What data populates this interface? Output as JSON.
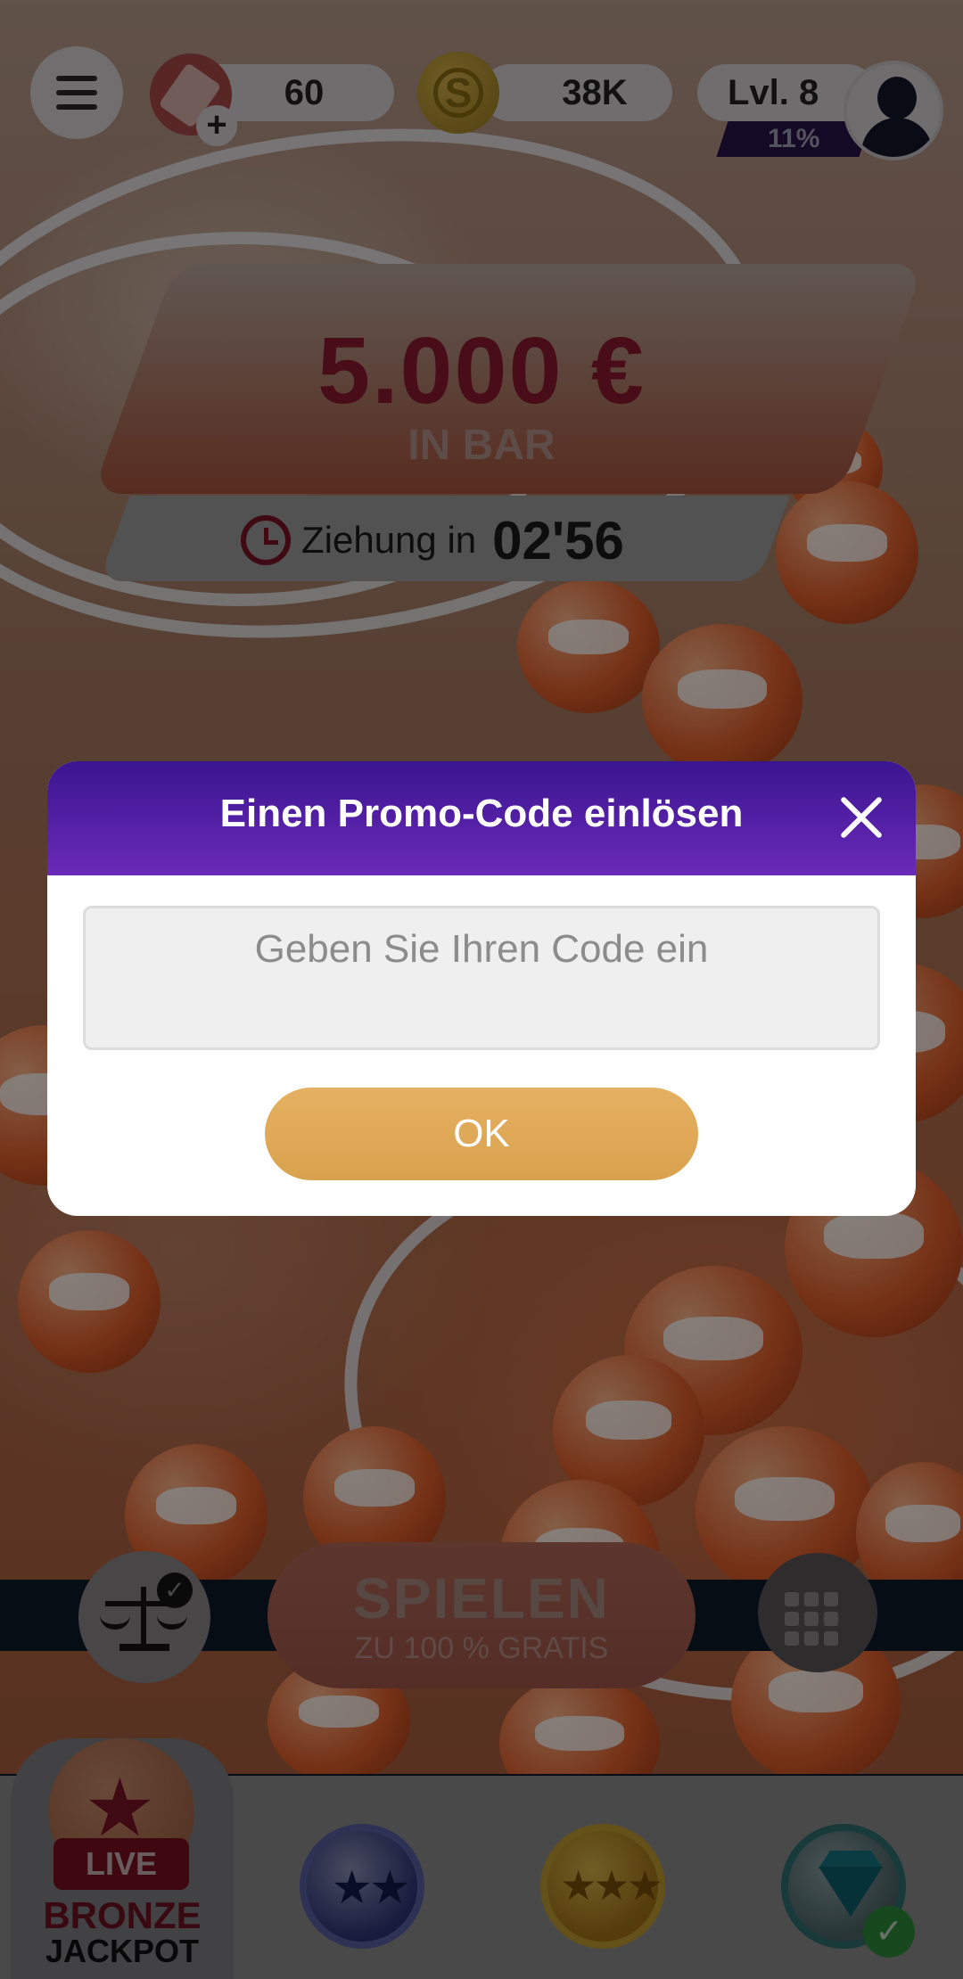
{
  "header": {
    "tickets_count": "60",
    "ticket_plus": "+",
    "coins_count": "38K",
    "level_label": "Lvl. 8",
    "level_progress": "11%",
    "icons": [
      "menu-icon",
      "ticket-icon",
      "coin-icon",
      "avatar-icon"
    ]
  },
  "jackpot": {
    "amount": "5.000 €",
    "subtitle": "IN BAR",
    "draw_label": "Ziehung in",
    "draw_countdown": "02'56"
  },
  "promo_modal": {
    "title": "Einen Promo-Code einlösen",
    "input_value": "",
    "input_placeholder": "Geben Sie Ihren Code ein",
    "ok_label": "OK"
  },
  "play": {
    "main_label": "SPIELEN",
    "sub_label": "ZU 100 % GRATIS"
  },
  "bottom_nav": {
    "live_badge": "LIVE",
    "live_name_line1": "BRONZE",
    "live_name_line2": "JACKPOT",
    "silver_stars": "★★",
    "gold_stars": "★★★",
    "diamond_check": "✓"
  },
  "colors": {
    "modal_header_start": "#3a1590",
    "modal_header_end": "#6a2ab8",
    "ok_button": "#d9a24e",
    "jackpot_amount": "#8b1a2f"
  }
}
